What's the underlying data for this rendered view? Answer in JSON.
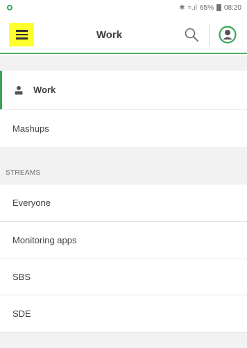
{
  "status_bar": {
    "signal_text": "65%",
    "time": "08:20"
  },
  "header": {
    "title": "Work",
    "menu_icon": "hamburger-icon",
    "search_icon": "search-icon",
    "avatar_icon": "user-avatar-icon",
    "accent_color": "#52b065",
    "menu_highlight": "#ffff2e"
  },
  "nav": {
    "work_label": "Work",
    "mashups_label": "Mashups"
  },
  "streams": {
    "heading": "STREAMS",
    "items": [
      {
        "label": "Everyone"
      },
      {
        "label": "Monitoring apps"
      },
      {
        "label": "SBS"
      },
      {
        "label": "SDE"
      }
    ]
  }
}
